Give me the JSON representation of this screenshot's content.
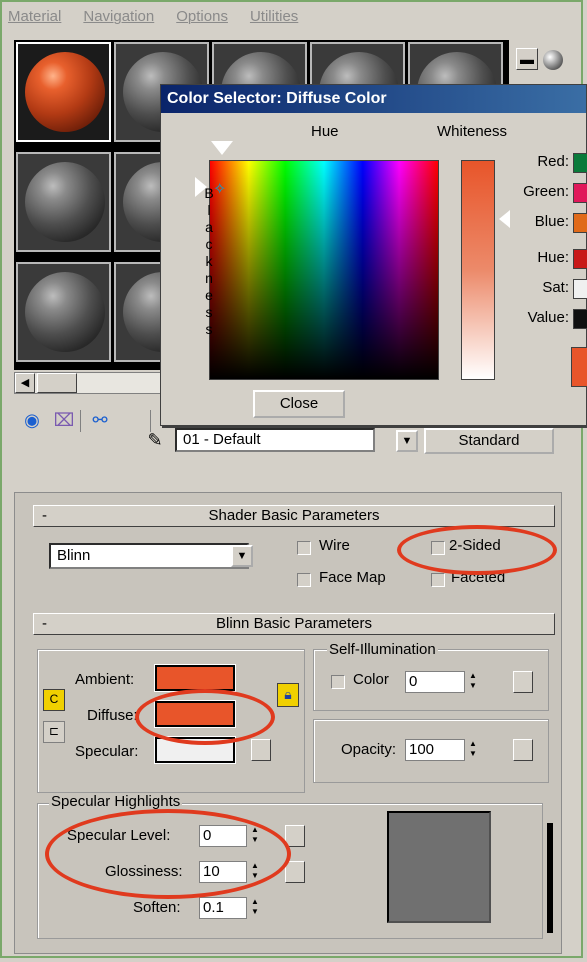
{
  "menu": [
    "Material",
    "Navigation",
    "Options",
    "Utilities"
  ],
  "dialog": {
    "title": "Color Selector: Diffuse Color",
    "hue_label": "Hue",
    "whiteness_label": "Whiteness",
    "blackness_letters": [
      "B",
      "l",
      "a",
      "c",
      "k",
      "n",
      "e",
      "s",
      "s"
    ],
    "fields": [
      "Red:",
      "Green:",
      "Blue:",
      "Hue:",
      "Sat:",
      "Value:"
    ],
    "field_colors": [
      "#0a7a3a",
      "#e0185a",
      "#e06a1a",
      "#c81818",
      "#f0f0f0",
      "#101010"
    ],
    "current_color": "#e8552a",
    "close_label": "Close"
  },
  "material": {
    "name": "01 - Default",
    "type_button": "Standard"
  },
  "shader_rollout": {
    "title": "Shader Basic Parameters",
    "collapse": "-",
    "shader": "Blinn",
    "wire": "Wire",
    "two_sided": "2-Sided",
    "face_map": "Face Map",
    "faceted": "Faceted"
  },
  "blinn_rollout": {
    "title": "Blinn Basic Parameters",
    "collapse": "-",
    "ambient_label": "Ambient:",
    "diffuse_label": "Diffuse:",
    "specular_label": "Specular:",
    "ambient_color": "#e8552a",
    "diffuse_color": "#e8552a",
    "specular_color": "#f0f0f0",
    "self_illum_title": "Self-Illumination",
    "color_label": "Color",
    "color_value": "0",
    "opacity_label": "Opacity:",
    "opacity_value": "100"
  },
  "specular_highlights": {
    "title": "Specular Highlights",
    "level_label": "Specular Level:",
    "level_value": "0",
    "gloss_label": "Glossiness:",
    "gloss_value": "10",
    "soften_label": "Soften:",
    "soften_value": "0.1"
  },
  "icons": [
    "sample-sphere-icon",
    "get-material-icon",
    "put-material-icon",
    "assign-material-icon",
    "eyedropper-icon",
    "lock-icon",
    "map-button-icon"
  ]
}
